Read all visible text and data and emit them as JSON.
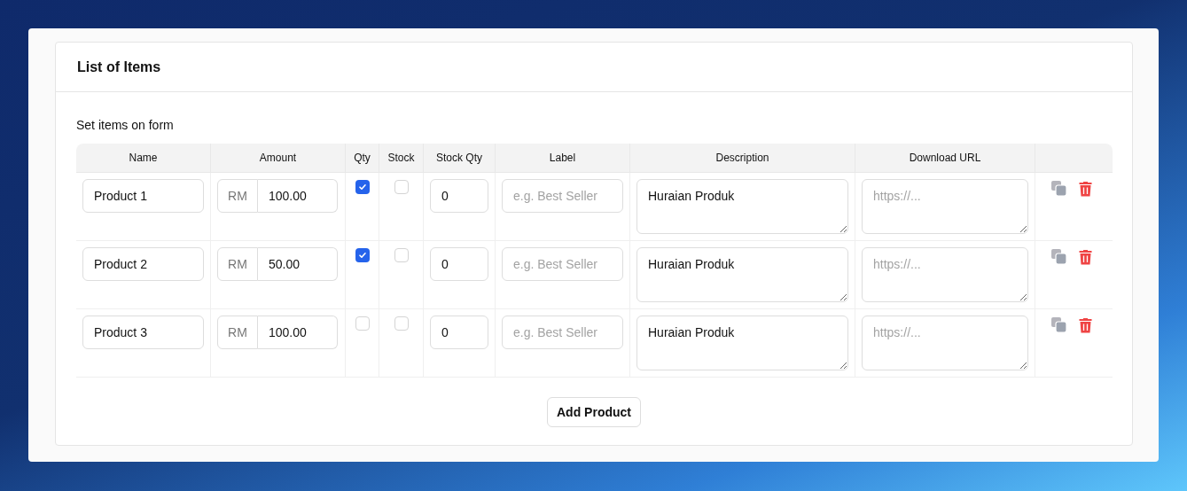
{
  "card": {
    "title": "List of Items",
    "subtitle": "Set items on form"
  },
  "table": {
    "columns": [
      "Name",
      "Amount",
      "Qty",
      "Stock",
      "Stock Qty",
      "Label",
      "Description",
      "Download URL"
    ],
    "rows": [
      {
        "name": "Product 1",
        "currency": "RM",
        "amount": "100.00",
        "qty": true,
        "stock": false,
        "stock_qty": "0",
        "label_placeholder": "e.g. Best Seller",
        "description": "Huraian Produk",
        "url_placeholder": "https://..."
      },
      {
        "name": "Product 2",
        "currency": "RM",
        "amount": "50.00",
        "qty": true,
        "stock": false,
        "stock_qty": "0",
        "label_placeholder": "e.g. Best Seller",
        "description": "Huraian Produk",
        "url_placeholder": "https://..."
      },
      {
        "name": "Product 3",
        "currency": "RM",
        "amount": "100.00",
        "qty": false,
        "stock": false,
        "stock_qty": "0",
        "label_placeholder": "e.g. Best Seller",
        "description": "Huraian Produk",
        "url_placeholder": "https://..."
      }
    ]
  },
  "add_button": "Add Product"
}
